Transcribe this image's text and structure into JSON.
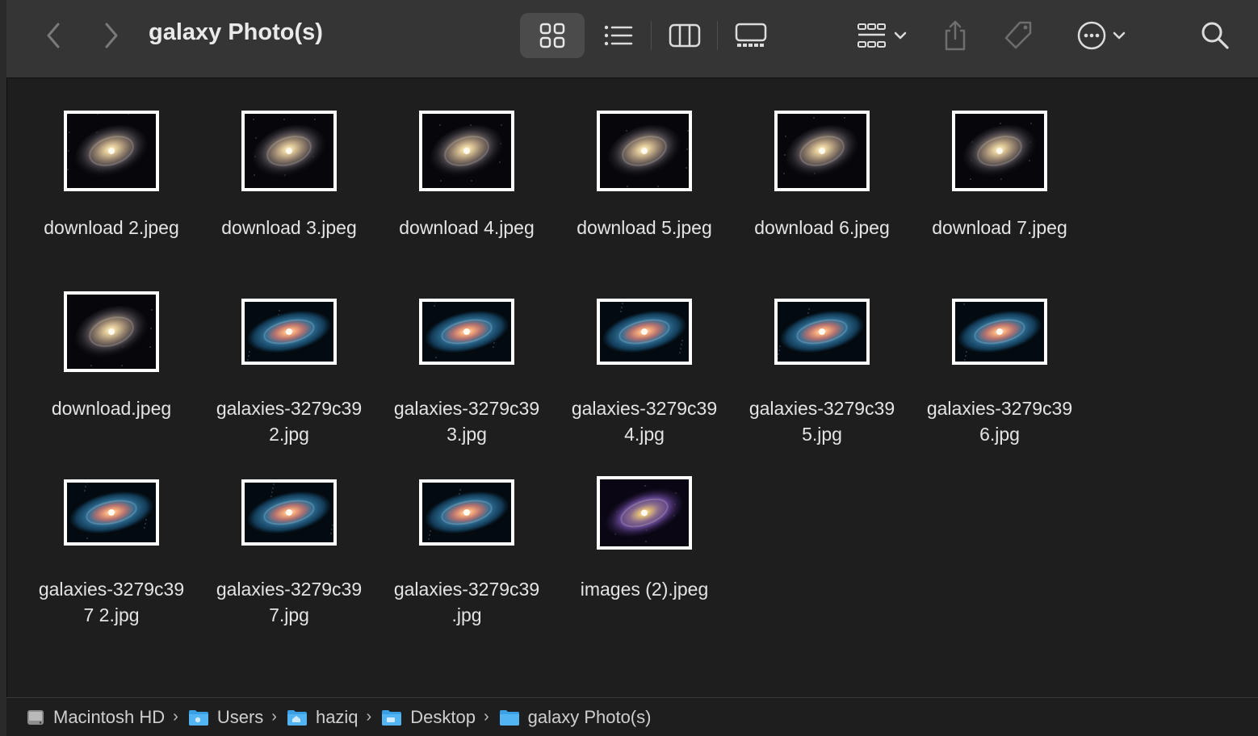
{
  "window": {
    "title": "galaxy Photo(s)"
  },
  "toolbar": {
    "back_icon": "chevron-left-icon",
    "forward_icon": "chevron-right-icon",
    "view_buttons": [
      "icon-view-icon",
      "list-view-icon",
      "column-view-icon",
      "gallery-view-icon"
    ],
    "active_view": "icon-view-icon",
    "group_icon": "group-by-icon",
    "share_icon": "share-icon",
    "tag_icon": "tag-icon",
    "more_icon": "more-actions-icon",
    "search_icon": "search-icon"
  },
  "files": [
    {
      "line1": "download 2.jpeg",
      "line2": "",
      "thumb": "spiral-gold"
    },
    {
      "line1": "download 3.jpeg",
      "line2": "",
      "thumb": "spiral-gold"
    },
    {
      "line1": "download 4.jpeg",
      "line2": "",
      "thumb": "spiral-gold"
    },
    {
      "line1": "download 5.jpeg",
      "line2": "",
      "thumb": "spiral-gold"
    },
    {
      "line1": "download 6.jpeg",
      "line2": "",
      "thumb": "spiral-gold"
    },
    {
      "line1": "download 7.jpeg",
      "line2": "",
      "thumb": "spiral-gold"
    },
    {
      "line1": "download.jpeg",
      "line2": "",
      "thumb": "spiral-gold"
    },
    {
      "line1": "galaxies-3279c39",
      "line2": "2.jpg",
      "thumb": "spiral-blue"
    },
    {
      "line1": "galaxies-3279c39",
      "line2": "3.jpg",
      "thumb": "spiral-blue"
    },
    {
      "line1": "galaxies-3279c39",
      "line2": "4.jpg",
      "thumb": "spiral-blue"
    },
    {
      "line1": "galaxies-3279c39",
      "line2": "5.jpg",
      "thumb": "spiral-blue"
    },
    {
      "line1": "galaxies-3279c39",
      "line2": "6.jpg",
      "thumb": "spiral-blue"
    },
    {
      "line1": "galaxies-3279c39",
      "line2": "7 2.jpg",
      "thumb": "spiral-blue"
    },
    {
      "line1": "galaxies-3279c39",
      "line2": "7.jpg",
      "thumb": "spiral-blue"
    },
    {
      "line1": "galaxies-3279c39",
      "line2": ".jpg",
      "thumb": "spiral-blue"
    },
    {
      "line1": "images (2).jpeg",
      "line2": "",
      "thumb": "spiral-purple"
    }
  ],
  "pathbar": [
    {
      "label": "Macintosh HD",
      "icon": "hard-drive-icon"
    },
    {
      "label": "Users",
      "icon": "users-folder-icon"
    },
    {
      "label": "haziq",
      "icon": "home-folder-icon"
    },
    {
      "label": "Desktop",
      "icon": "desktop-folder-icon"
    },
    {
      "label": "galaxy Photo(s)",
      "icon": "folder-icon"
    }
  ],
  "colors": {
    "toolbar_bg": "#353535",
    "window_bg": "#1e1e1e",
    "folder_blue": "#3aa0e6"
  }
}
